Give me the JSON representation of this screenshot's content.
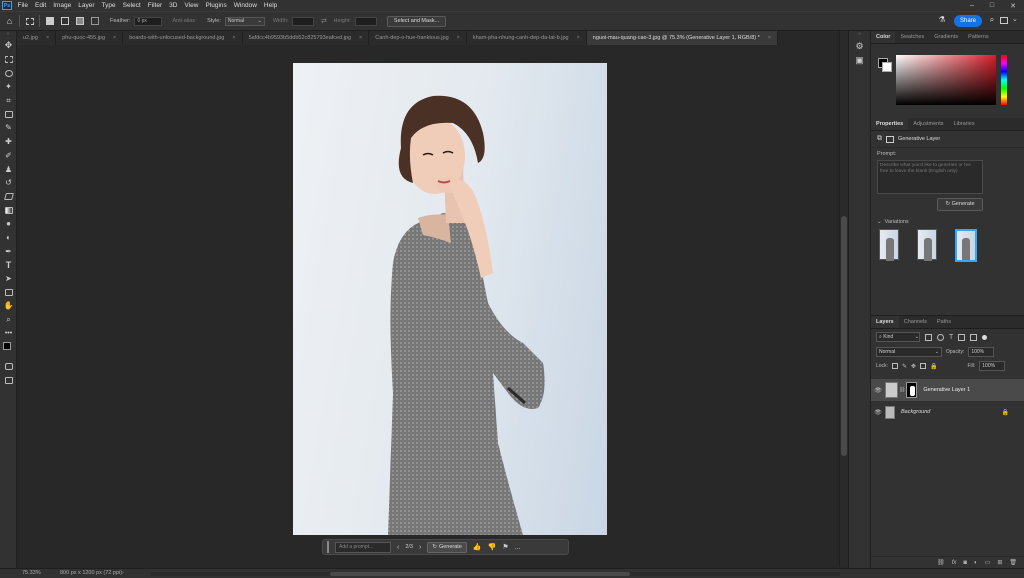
{
  "menu": {
    "app_logo": "Ps",
    "items": [
      "File",
      "Edit",
      "Image",
      "Layer",
      "Type",
      "Select",
      "Filter",
      "3D",
      "View",
      "Plugins",
      "Window",
      "Help"
    ]
  },
  "options": {
    "feather_label": "Feather:",
    "feather_value": "0 px",
    "antialias_label": "Anti-alias",
    "style_label": "Style:",
    "style_value": "Normal",
    "width_label": "Width:",
    "height_label": "Height:",
    "select_mask_label": "Select and Mask...",
    "share_label": "Share"
  },
  "tabs": [
    {
      "label": "u2.jpg",
      "active": false
    },
    {
      "label": "phu-quoc-455.jpg",
      "active": false
    },
    {
      "label": "boards-with-unfocused-background.jpg",
      "active": false
    },
    {
      "label": "5afdcc4b9593b5ddb52c825793eafced.jpg",
      "active": false
    },
    {
      "label": "Canh-dep-o-hue-franktous.jpg",
      "active": false
    },
    {
      "label": "kham-pha-nhung-canh-dep-da-lat-b.jpg",
      "active": false
    },
    {
      "label": "nguoi-mau-quang-cao-3.jpg @ 75.3% (Generative Layer 1, RGB/8) *",
      "active": true
    }
  ],
  "tab_close": "×",
  "color_panel": {
    "tabs": [
      "Color",
      "Swatches",
      "Gradients",
      "Patterns"
    ],
    "hue_color": "#d61f2a"
  },
  "properties_panel": {
    "tabs": [
      "Properties",
      "Adjustments",
      "Libraries"
    ],
    "layer_type": "Generative Layer",
    "prompt_label": "Prompt:",
    "prompt_placeholder": "Describe what you'd like to generate or fee free to leave the blank (English only)",
    "generate_label": "Generate",
    "variations_label": "Variations"
  },
  "layers_panel": {
    "tabs": [
      "Layers",
      "Channels",
      "Paths"
    ],
    "kind_label": "Kind",
    "blend_mode": "Normal",
    "opacity_label": "Opacity:",
    "opacity_value": "100%",
    "lock_label": "Lock:",
    "fill_label": "Fill:",
    "fill_value": "100%",
    "layers": [
      {
        "name": "Generative Layer 1",
        "selected": true
      },
      {
        "name": "Background",
        "selected": false
      }
    ]
  },
  "context_bar": {
    "prompt_placeholder": "Add a prompt...",
    "page": "2/3",
    "generate_label": "Generate",
    "more_label": "..."
  },
  "status": {
    "zoom": "75.33%",
    "doc_size": "800 px x 1200 px (72 ppi)"
  },
  "colors": {
    "accent": "#1473e6",
    "selection": "#31a8ff"
  }
}
